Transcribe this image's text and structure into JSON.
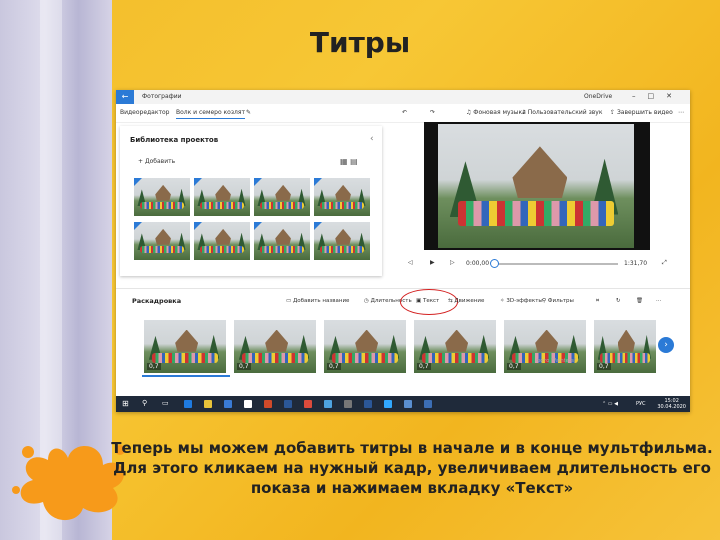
{
  "slide": {
    "title": "Титры",
    "caption_lines": [
      "Теперь мы можем добавить титры в начале и в конце мультфильма.",
      "Для этого кликаем на нужный кадр, увеличиваем длительность его показа и нажимаем вкладку «Текст»"
    ]
  },
  "window": {
    "app_name": "Фотографии",
    "onedrive": "OneDrive",
    "editor_label": "Видеоредактор",
    "project_name": "Волк и семеро козлят",
    "toolbar": {
      "music": "Фоновая музыка",
      "custom_sound": "Пользовательский звук",
      "finish": "Завершить видео"
    }
  },
  "library": {
    "title": "Библиотека проектов",
    "add_label": "Добавить"
  },
  "player": {
    "current_time": "0:00,00",
    "total_time": "1:31,70",
    "progress": 0.0
  },
  "storyboard": {
    "title": "Раскадровка",
    "tools": {
      "add_title": "Добавить название",
      "duration": "Длительность",
      "text": "Текст",
      "motion": "Движение",
      "effects_3d": "3D-эффекты",
      "filters": "Фильтры"
    },
    "frames": [
      "0,7",
      "0,7",
      "0,7",
      "0,7",
      "0,7",
      "0,7"
    ],
    "watermark": "фото \"Paintecs\""
  },
  "taskbar": {
    "lang": "РУС",
    "time": "15:02",
    "date": "30.04.2020"
  },
  "colors": {
    "accent": "#2b7ad6",
    "highlight_ring": "#d32020",
    "background": "#f3bd2a"
  }
}
